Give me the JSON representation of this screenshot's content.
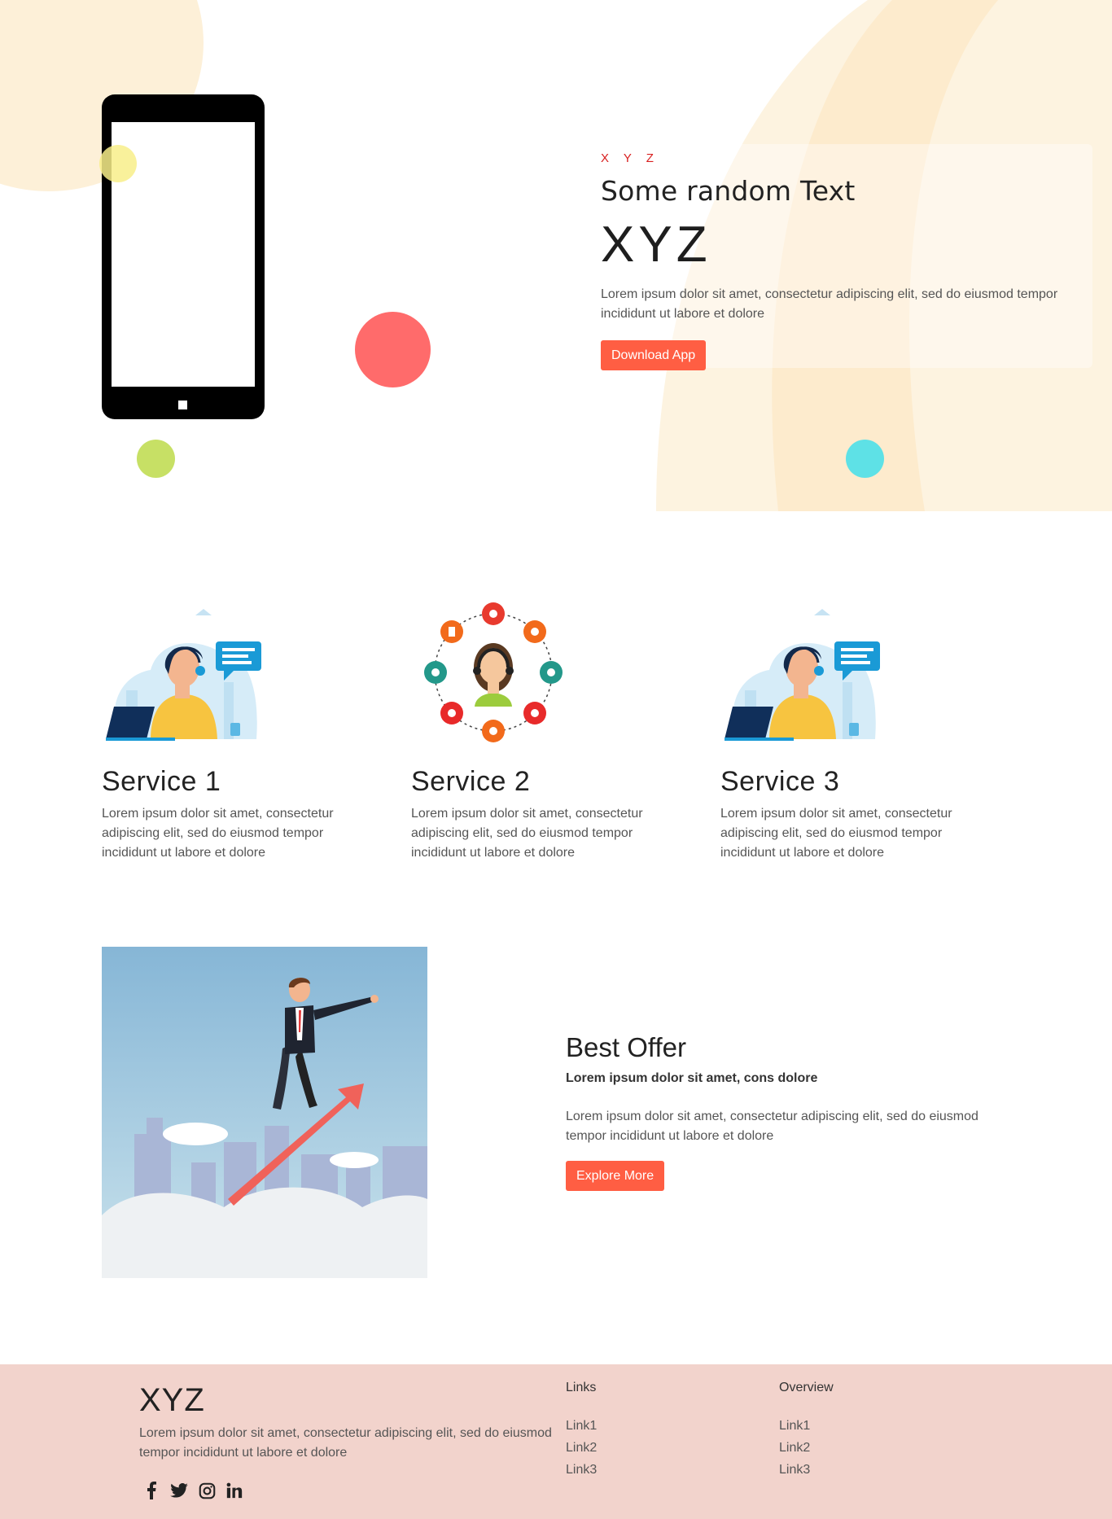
{
  "hero": {
    "kicker": "X Y Z",
    "subtitle": "Some random Text",
    "title": "XYZ",
    "description": "Lorem ipsum dolor sit amet, consectetur adipiscing elit, sed do eiusmod tempor incididunt ut labore et dolore",
    "cta_label": "Download App"
  },
  "services": [
    {
      "title": "Service 1",
      "description": "Lorem ipsum dolor sit amet, consectetur adipiscing elit, sed do eiusmod tempor incididunt ut labore et dolore",
      "illustration": "support-agent-laptop"
    },
    {
      "title": "Service 2",
      "description": "Lorem ipsum dolor sit amet, consectetur adipiscing elit, sed do eiusmod tempor incididunt ut labore et dolore",
      "illustration": "support-agent-icons-circle"
    },
    {
      "title": "Service 3",
      "description": "Lorem ipsum dolor sit amet, consectetur adipiscing elit, sed do eiusmod tempor incididunt ut labore et dolore",
      "illustration": "support-agent-laptop"
    }
  ],
  "offer": {
    "title": "Best Offer",
    "subtitle": "Lorem ipsum dolor sit amet, cons dolore",
    "description": "Lorem ipsum dolor sit amet, consectetur adipiscing elit, sed do eiusmod tempor incididunt ut labore et dolore",
    "cta_label": "Explore More",
    "illustration": "businessman-on-red-arrow"
  },
  "footer": {
    "brand": "XYZ",
    "description": "Lorem ipsum dolor sit amet, consectetur adipiscing elit, sed do eiusmod tempor incididunt ut labore et dolore",
    "social": [
      "facebook-icon",
      "twitter-icon",
      "instagram-icon",
      "linkedin-icon"
    ],
    "links": {
      "heading": "Links",
      "items": [
        "Link1",
        "Link2",
        "Link3"
      ]
    },
    "overview": {
      "heading": "Overview",
      "items": [
        "Link1",
        "Link2",
        "Link3"
      ]
    }
  },
  "colors": {
    "accent": "#ff5e43",
    "kicker": "#d81f1f",
    "footer_bg": "#f2d3cc",
    "hero_blob": "#fdf0d8"
  }
}
